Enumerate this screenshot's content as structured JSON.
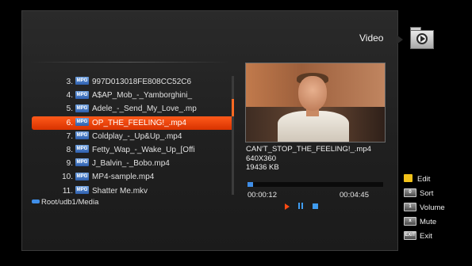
{
  "header": {
    "title": "Video",
    "folder_icon": "video-folder-icon"
  },
  "file_list": {
    "badge_label": "MPG",
    "items": [
      {
        "num": "3.",
        "name": "997D013018FE808CC52C6"
      },
      {
        "num": "4.",
        "name": "A$AP_Mob_-_Yamborghini_"
      },
      {
        "num": "5.",
        "name": "Adele_-_Send_My_Love_.mp"
      },
      {
        "num": "6.",
        "name": "OP_THE_FEELING!_.mp4"
      },
      {
        "num": "7.",
        "name": "Coldplay_-_Up&Up_.mp4"
      },
      {
        "num": "8.",
        "name": "Fetty_Wap_-_Wake_Up_[Offi"
      },
      {
        "num": "9.",
        "name": "J_Balvin_-_Bobo.mp4"
      },
      {
        "num": "10.",
        "name": "MP4-sample.mp4"
      },
      {
        "num": "11.",
        "name": "Shatter Me.mkv"
      }
    ],
    "selected_index": 3
  },
  "path": "Root/udb1/Media",
  "preview": {
    "filename": "CAN'T_STOP_THE_FEELING!_.mp4",
    "resolution": "640X360",
    "size": "19436 KB",
    "time_current": "00:00:12",
    "time_total": "00:04:45",
    "progress_fraction": 0.04
  },
  "legend": [
    {
      "key": "",
      "key_style": "yellow",
      "label": "Edit"
    },
    {
      "key": "0",
      "key_style": "gray",
      "label": "Sort"
    },
    {
      "key": "1",
      "key_style": "gray",
      "label": "Volume"
    },
    {
      "key": "x",
      "key_style": "gray",
      "label": "Mute"
    },
    {
      "key": "EXIT",
      "key_style": "gray",
      "label": "Exit"
    }
  ],
  "colors": {
    "accent": "#ff4a12",
    "highlight_blue": "#3f8ee8"
  }
}
